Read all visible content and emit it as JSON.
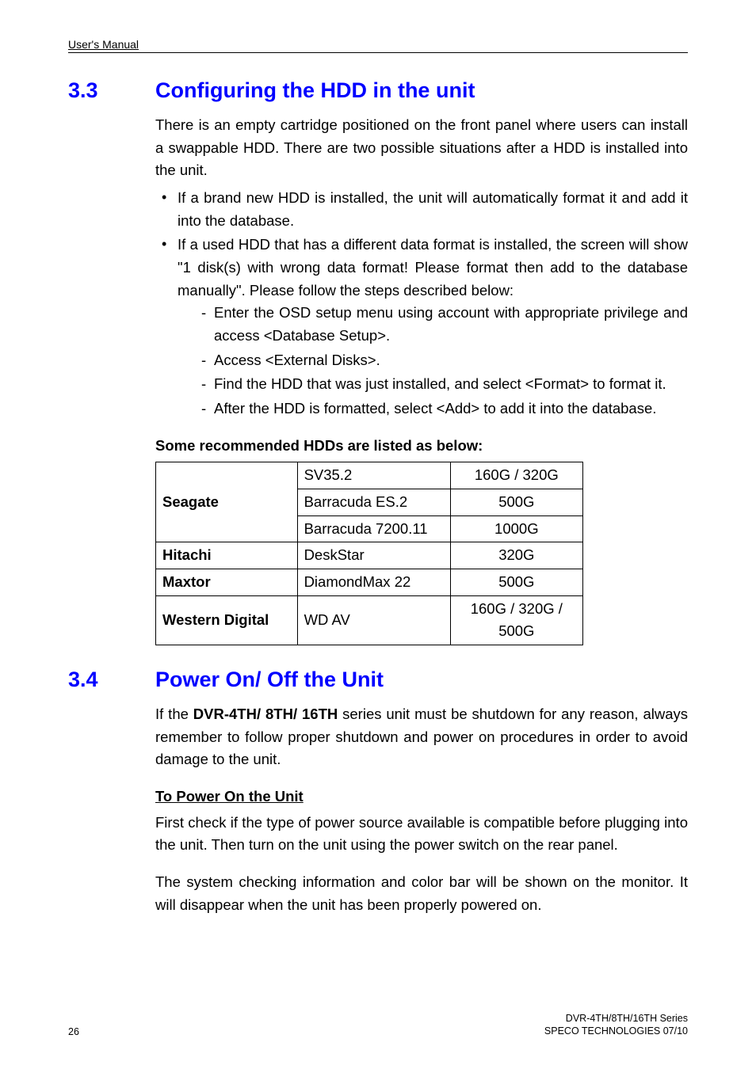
{
  "header": "User's Manual",
  "sections": [
    {
      "number": "3.3",
      "title": "Configuring the HDD in the unit",
      "intro": "There is an empty cartridge positioned on the front panel where users can install a swappable HDD. There are two possible situations after a HDD is installed into the unit.",
      "bullets": [
        {
          "text": "If a brand new HDD is installed, the unit will automatically format it and add it into the database.",
          "sub": []
        },
        {
          "text": "If a used HDD that has a different data format is installed, the screen will show \"1 disk(s) with wrong data format! Please format then add to the database manually\". Please follow the steps described below:",
          "sub": [
            "Enter the OSD setup menu using account with appropriate privilege and access <Database Setup>.",
            "Access <External Disks>.",
            "Find the HDD that was just installed, and select <Format> to format it.",
            "After the HDD is formatted, select <Add> to add it into the database."
          ]
        }
      ],
      "table_caption": "Some recommended HDDs are listed as below:",
      "table_rows": [
        {
          "brand": "Seagate",
          "model": "SV35.2",
          "cap": "160G / 320G",
          "rowspan": 3,
          "first": true
        },
        {
          "brand": "",
          "model": "Barracuda ES.2",
          "cap": "500G",
          "first": false
        },
        {
          "brand": "",
          "model": "Barracuda 7200.11",
          "cap": "1000G",
          "first": false
        },
        {
          "brand": "Hitachi",
          "model": "DeskStar",
          "cap": "320G",
          "rowspan": 1,
          "first": true
        },
        {
          "brand": "Maxtor",
          "model": "DiamondMax 22",
          "cap": "500G",
          "rowspan": 1,
          "first": true
        },
        {
          "brand": "Western Digital",
          "model": "WD AV",
          "cap": "160G / 320G / 500G",
          "rowspan": 1,
          "first": true
        }
      ]
    },
    {
      "number": "3.4",
      "title": "Power On/ Off the Unit",
      "intro_prefix": "If the ",
      "intro_bold": "DVR-4TH/ 8TH/ 16TH",
      "intro_suffix": " series unit must be shutdown for any reason, always remember to follow proper shutdown and power on procedures in order to avoid damage to the unit.",
      "subheading": "To Power On the Unit",
      "para1": "First check if the type of power source available is compatible before plugging into the unit. Then turn on the unit using the power switch on the rear panel.",
      "para2": "The system checking information and color bar will be shown on the monitor. It will disappear when the unit has been properly powered on."
    }
  ],
  "footer": {
    "page": "26",
    "line1": "DVR-4TH/8TH/16TH Series",
    "line2": "SPECO TECHNOLOGIES 07/10"
  }
}
